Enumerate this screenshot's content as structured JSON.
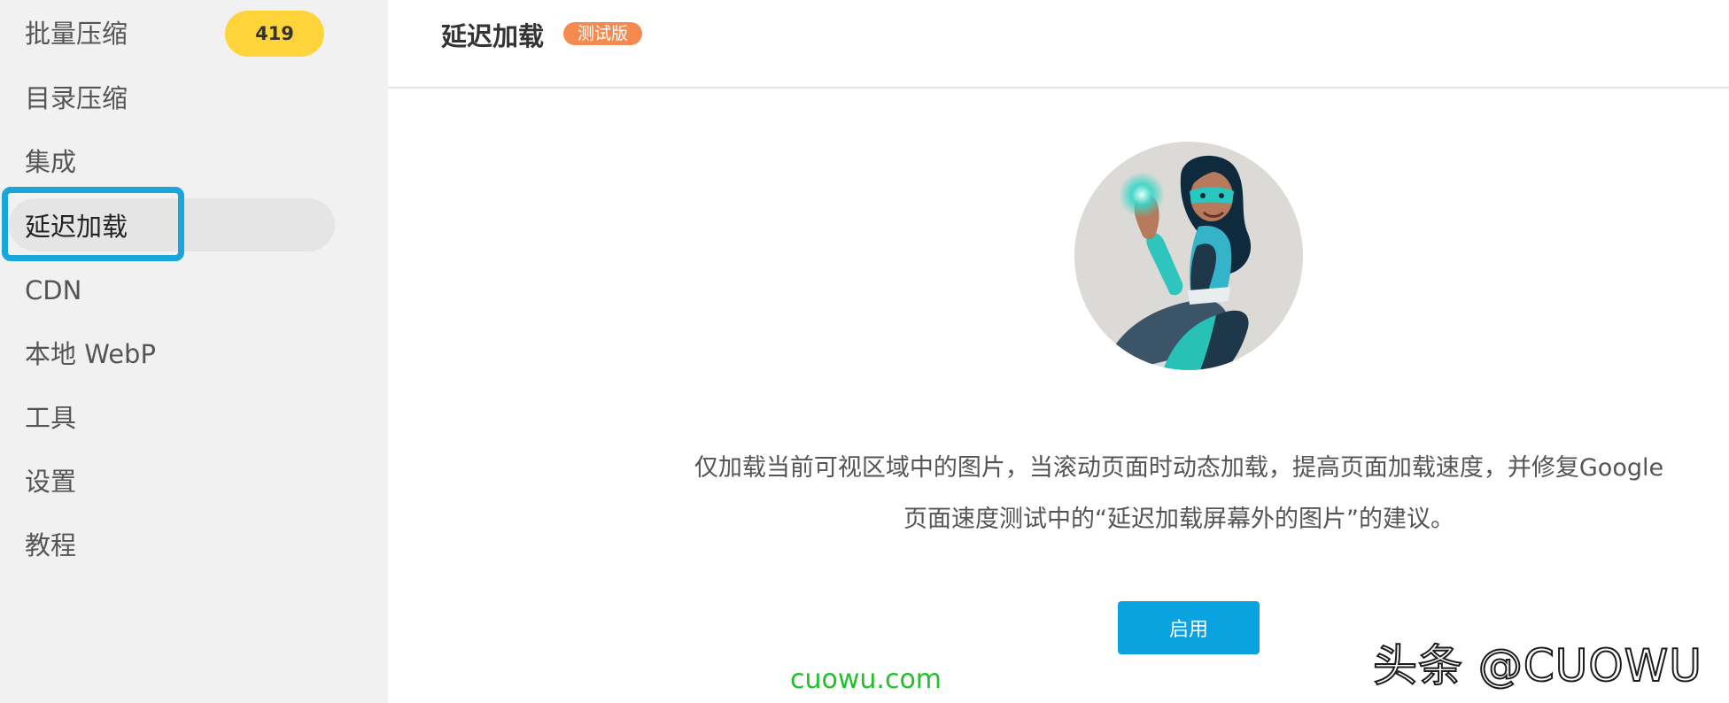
{
  "sidebar": {
    "items": [
      {
        "label": "批量压缩",
        "badge": "419"
      },
      {
        "label": "目录压缩"
      },
      {
        "label": "集成"
      },
      {
        "label": "延迟加载",
        "active": true
      },
      {
        "label": "CDN"
      },
      {
        "label": "本地 WebP"
      },
      {
        "label": "工具"
      },
      {
        "label": "设置"
      },
      {
        "label": "教程"
      }
    ],
    "highlight_color": "#1aa6d9",
    "badge_color": "#ffd43b"
  },
  "header": {
    "title": "延迟加载",
    "badge": "测试版",
    "badge_color": "#f58a50"
  },
  "main": {
    "illustration_icon": "superhero-avatar",
    "description_line1": "仅加载当前可视区域中的图片，当滚动页面时动态加载，提高页面加载速度，并修复Google",
    "description_line2": "页面速度测试中的“延迟加载屏幕外的图片”的建议。",
    "enable_label": "启用",
    "enable_color": "#0aa3e0"
  },
  "watermark": {
    "url": "cuowu.com",
    "brand": "头条 @CUOWU"
  }
}
